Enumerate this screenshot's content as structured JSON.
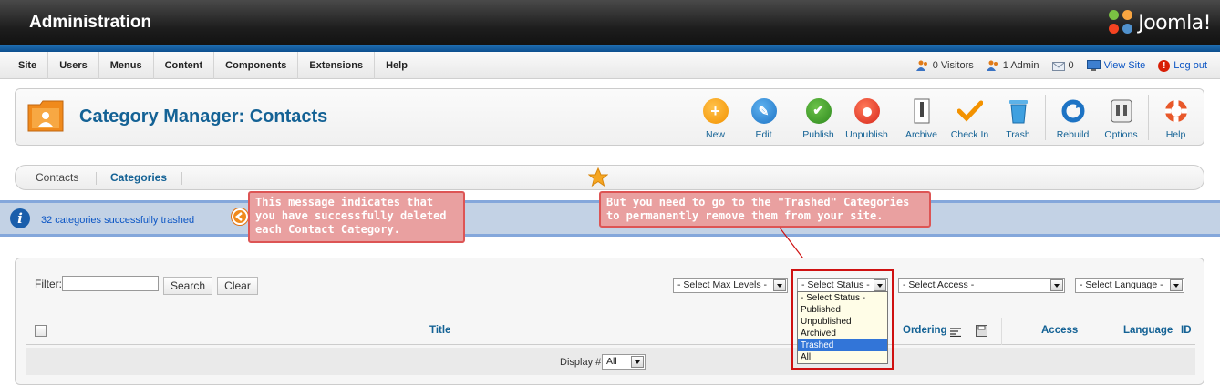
{
  "header": {
    "title": "Administration",
    "brand": "Joomla!"
  },
  "menu": {
    "items": [
      "Site",
      "Users",
      "Menus",
      "Content",
      "Components",
      "Extensions",
      "Help"
    ]
  },
  "status": {
    "visitors": "0 Visitors",
    "admins": "1 Admin",
    "messages": "0",
    "view_site": "View Site",
    "logout": "Log out"
  },
  "toolbar": {
    "page_title": "Category Manager: Contacts",
    "buttons": {
      "new": "New",
      "edit": "Edit",
      "publish": "Publish",
      "unpublish": "Unpublish",
      "archive": "Archive",
      "checkin": "Check In",
      "trash": "Trash",
      "rebuild": "Rebuild",
      "options": "Options",
      "help": "Help"
    }
  },
  "submenu": {
    "contacts": "Contacts",
    "categories": "Categories"
  },
  "message": {
    "text": "32 categories successfully trashed"
  },
  "callouts": {
    "first": "This message indicates that you have successfully deleted each Contact Category.",
    "second": "But you need to go to the \"Trashed\" Categories to permanently remove them from your site."
  },
  "filter": {
    "label": "Filter:",
    "value": "",
    "search_button": "Search",
    "clear_button": "Clear",
    "max_levels": "- Select Max Levels -",
    "status": "- Select Status -",
    "access": "- Select Access -",
    "language": "- Select Language -"
  },
  "status_options": [
    "- Select Status -",
    "Published",
    "Unpublished",
    "Archived",
    "Trashed",
    "All"
  ],
  "table": {
    "columns": {
      "title": "Title",
      "ordering": "Ordering",
      "access": "Access",
      "language": "Language",
      "id": "ID"
    },
    "display_label": "Display #",
    "display_value": "All"
  },
  "colors": {
    "accent": "#146295",
    "message_bg": "#c3d2e5",
    "callout_bg": "#e9a0a0",
    "highlight": "#cf1111"
  }
}
